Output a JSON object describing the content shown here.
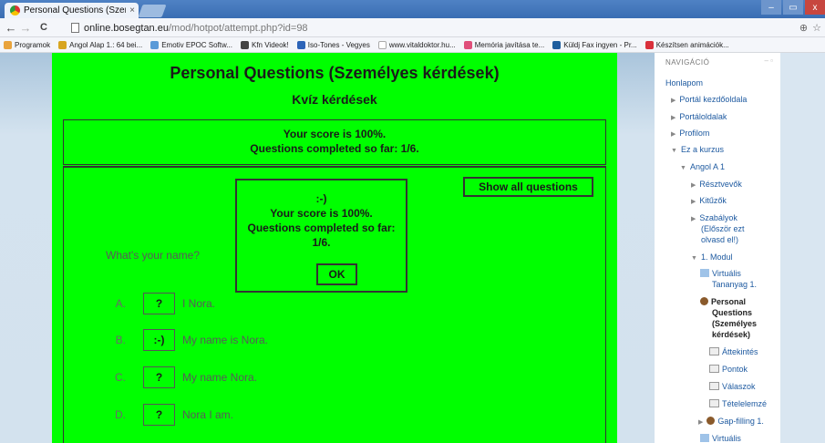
{
  "browser": {
    "tab_title": "Personal Questions (Szem",
    "tab_close": "×",
    "url_host": "online.bosegtan.eu",
    "url_path": "/mod/hotpot/attempt.php?id=98",
    "nav_back": "←",
    "nav_forward": "→",
    "nav_reload": "C",
    "zoom_icon": "⊕",
    "star_icon": "☆",
    "win_min": "–",
    "win_max": "▭",
    "win_close": "x",
    "bookmarks": [
      "Programok",
      "Angol Alap 1.: 64 bei...",
      "Emotiv EPOC Softw...",
      "Kfn Videok!",
      "Iso-Tones - Vegyes",
      "www.vitaldoktor.hu...",
      "Memória javítása te...",
      "Küldj Fax ingyen - Pr...",
      "Készítsen animációk..."
    ],
    "colors": {
      "tabstrip": "#3a6db3"
    }
  },
  "quiz": {
    "title": "Personal Questions (Személyes kérdések)",
    "subtitle": "Kvíz kérdések",
    "score_line1": "Your score is 100%.",
    "score_line2": "Questions completed so far: 1/6.",
    "show_all_label": "Show all questions",
    "popup": {
      "line1": ":-)",
      "line2": "Your score is 100%.",
      "line3": "Questions completed so far:",
      "line4": "1/6.",
      "ok_label": "OK"
    },
    "question": "What's your name?",
    "answers": [
      {
        "letter": "A.",
        "button": "?",
        "text": "I Nora."
      },
      {
        "letter": "B.",
        "button": ":-)",
        "text": "My name is Nora."
      },
      {
        "letter": "C.",
        "button": "?",
        "text": "My name Nora."
      },
      {
        "letter": "D.",
        "button": "?",
        "text": "Nora I am."
      }
    ],
    "background_color": "#00ff00"
  },
  "sidebar": {
    "header": "NAVIGÁCIÓ",
    "items": [
      {
        "label": "Honlapom"
      },
      {
        "label": "Portál kezdőoldala"
      },
      {
        "label": "Portáloldalak"
      },
      {
        "label": "Profilom"
      },
      {
        "label": "Ez a kurzus"
      },
      {
        "label": "Angol A 1"
      },
      {
        "label": "Résztvevők"
      },
      {
        "label": "Kitűzők"
      },
      {
        "label": "Szabályok"
      },
      {
        "label": "(Először ezt"
      },
      {
        "label": "olvasd el!)"
      },
      {
        "label": "1. Modul"
      },
      {
        "label": "Virtuális"
      },
      {
        "label": "Tananyag 1."
      },
      {
        "label": "Personal"
      },
      {
        "label": "Questions"
      },
      {
        "label": "(Személyes"
      },
      {
        "label": "kérdések)"
      },
      {
        "label": "Áttekintés"
      },
      {
        "label": "Pontok"
      },
      {
        "label": "Válaszok"
      },
      {
        "label": "Tételelemzé"
      },
      {
        "label": "Gap-filling 1."
      },
      {
        "label": "Virtuális"
      }
    ]
  }
}
